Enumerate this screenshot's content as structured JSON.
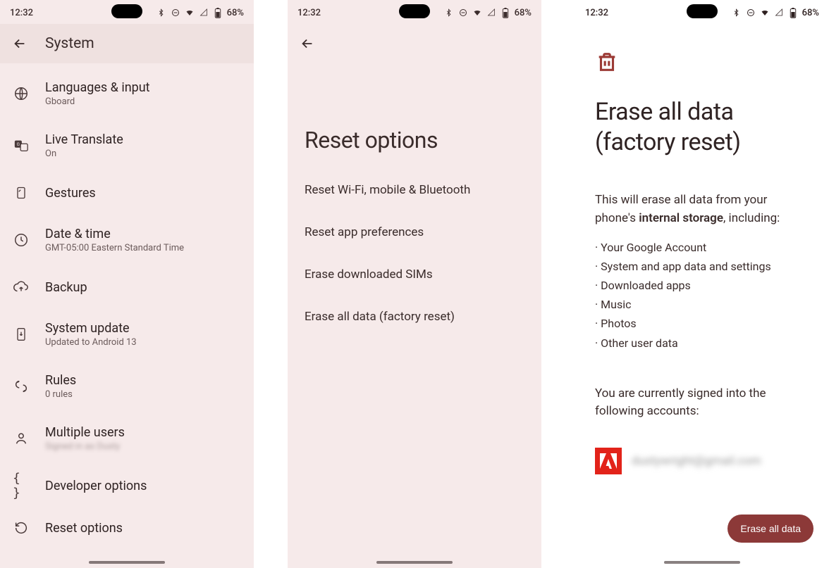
{
  "status": {
    "time": "12:32",
    "battery": "68%"
  },
  "screen1": {
    "header": "System",
    "items": [
      {
        "title": "Languages & input",
        "sub": "Gboard"
      },
      {
        "title": "Live Translate",
        "sub": "On"
      },
      {
        "title": "Gestures",
        "sub": ""
      },
      {
        "title": "Date & time",
        "sub": "GMT-05:00 Eastern Standard Time"
      },
      {
        "title": "Backup",
        "sub": ""
      },
      {
        "title": "System update",
        "sub": "Updated to Android 13"
      },
      {
        "title": "Rules",
        "sub": "0 rules"
      },
      {
        "title": "Multiple users",
        "sub": "Signed in as Dusty"
      },
      {
        "title": "Developer options",
        "sub": ""
      },
      {
        "title": "Reset options",
        "sub": ""
      }
    ]
  },
  "screen2": {
    "title": "Reset options",
    "options": [
      "Reset Wi-Fi, mobile & Bluetooth",
      "Reset app preferences",
      "Erase downloaded SIMs",
      "Erase all data (factory reset)"
    ]
  },
  "screen3": {
    "title_line1": "Erase all data",
    "title_line2": "(factory reset)",
    "intro_pre": "This will erase all data from your phone's ",
    "intro_strong": "internal storage",
    "intro_post": ", including:",
    "bullets": [
      "Your Google Account",
      "System and app data and settings",
      "Downloaded apps",
      "Music",
      "Photos",
      "Other user data"
    ],
    "signed_in": "You are currently signed into the following accounts:",
    "account_email": "dustywright@gmail.com",
    "button": "Erase all data"
  }
}
